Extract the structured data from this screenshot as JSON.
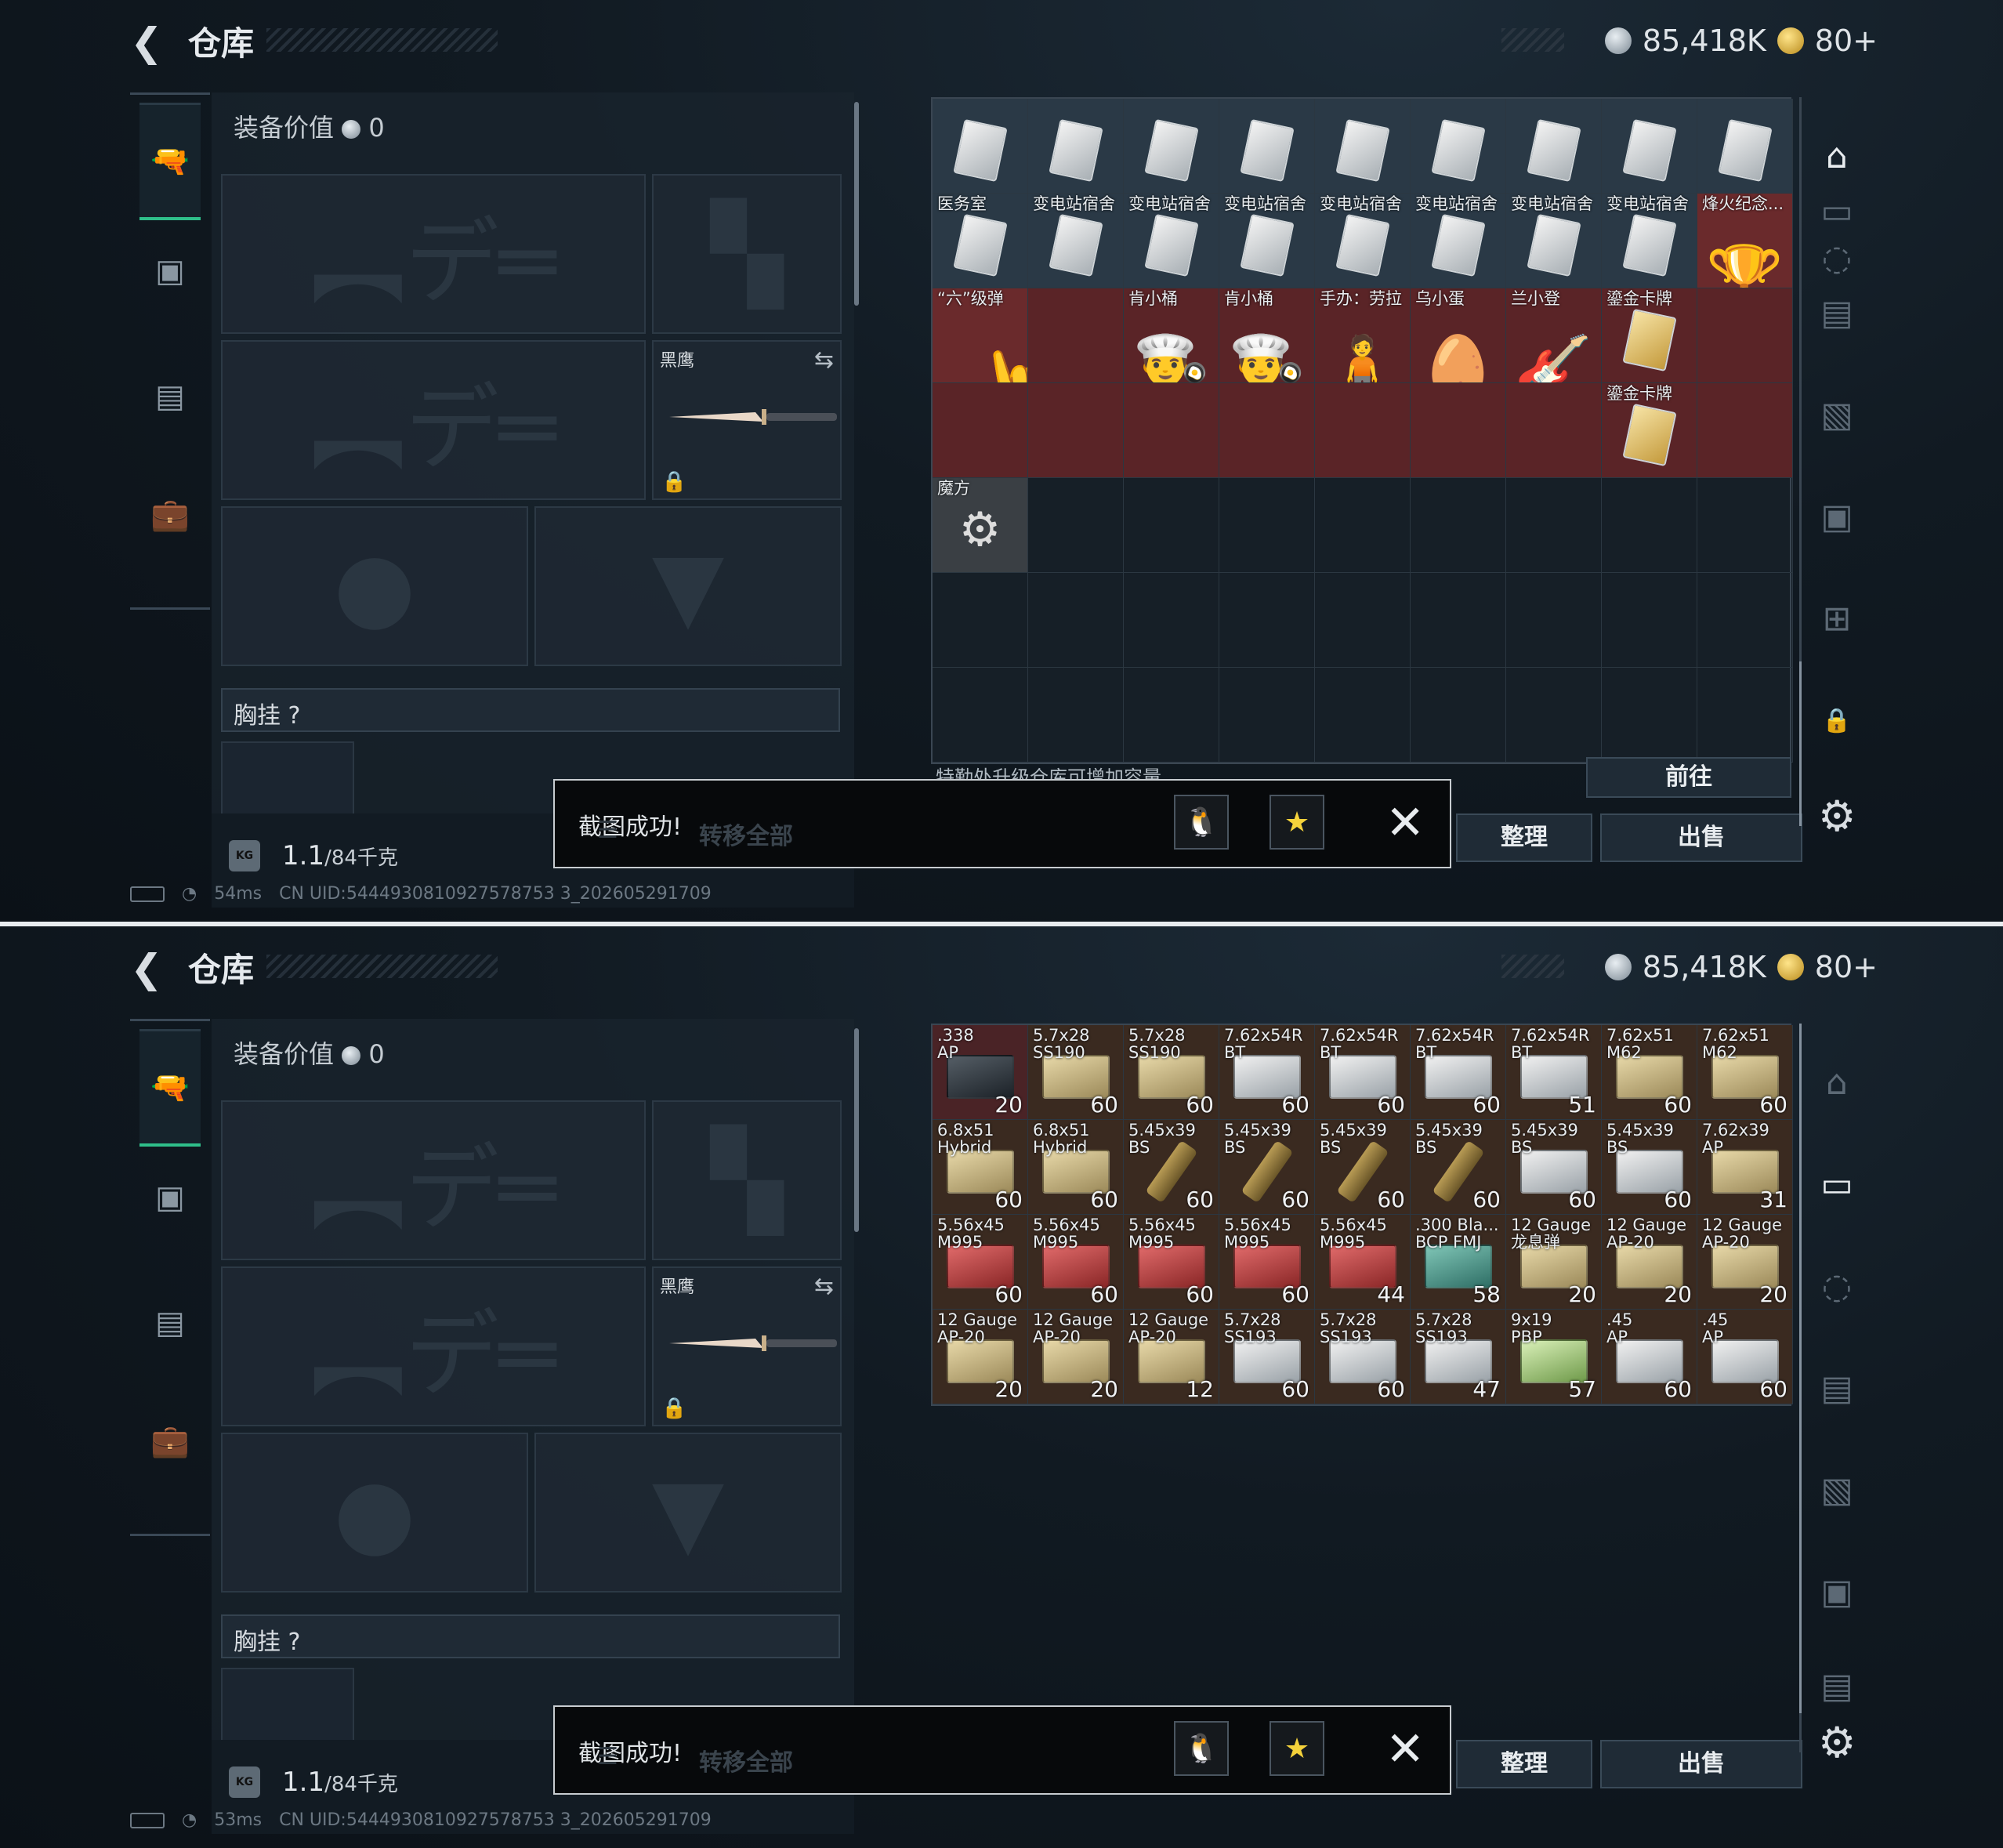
{
  "header": {
    "title": "仓库",
    "silver": "85,418K",
    "gold": "80+"
  },
  "equip": {
    "label": "装备价值",
    "value": "0",
    "knife_name": "黑鹰",
    "chest_label": "胸挂 ?",
    "weight": "1.1",
    "weight_max": "/84千克",
    "kg_icon": "KG"
  },
  "actions": {
    "go": "前往",
    "organize": "整理",
    "sell": "出售",
    "transfer_all": "转移全部",
    "upgrade_tip": "特勤处升级仓库可增加容量"
  },
  "toast": {
    "text": "截图成功!"
  },
  "status_top": {
    "ping": "54ms",
    "uid": "CN UID:5444930810927578753 3_202605291709"
  },
  "status_bottom": {
    "ping": "53ms",
    "uid": "CN UID:5444930810927578753 3_202605291709"
  },
  "top_grid": [
    {
      "name": "",
      "type": "card"
    },
    {
      "name": "",
      "type": "card"
    },
    {
      "name": "",
      "type": "card"
    },
    {
      "name": "",
      "type": "card"
    },
    {
      "name": "",
      "type": "card"
    },
    {
      "name": "",
      "type": "card"
    },
    {
      "name": "",
      "type": "card"
    },
    {
      "name": "",
      "type": "card"
    },
    {
      "name": "",
      "type": "card"
    },
    {
      "name": "医务室",
      "type": "card"
    },
    {
      "name": "变电站宿舍",
      "type": "card"
    },
    {
      "name": "变电站宿舍",
      "type": "card"
    },
    {
      "name": "变电站宿舍",
      "type": "card"
    },
    {
      "name": "变电站宿舍",
      "type": "card"
    },
    {
      "name": "变电站宿舍",
      "type": "card"
    },
    {
      "name": "变电站宿舍",
      "type": "card"
    },
    {
      "name": "变电站宿舍",
      "type": "card"
    },
    {
      "name": "烽火纪念...",
      "type": "trophy"
    },
    {
      "name": "“六”级弹",
      "type": "hand"
    },
    {
      "name": "",
      "type": "span"
    },
    {
      "name": "肯小桶",
      "type": "fig"
    },
    {
      "name": "肯小桶",
      "type": "fig"
    },
    {
      "name": "手办：劳拉",
      "type": "fig"
    },
    {
      "name": "乌小蛋",
      "type": "fig"
    },
    {
      "name": "兰小登",
      "type": "fig"
    },
    {
      "name": "鎏金卡牌",
      "type": "gold"
    },
    {
      "name": "",
      "type": "span"
    },
    {
      "name": "",
      "type": "span"
    },
    {
      "name": "",
      "type": "span"
    },
    {
      "name": "",
      "type": "span"
    },
    {
      "name": "",
      "type": "span"
    },
    {
      "name": "",
      "type": "span"
    },
    {
      "name": "",
      "type": "span"
    },
    {
      "name": "",
      "type": "span"
    },
    {
      "name": "鎏金卡牌",
      "type": "gold"
    },
    {
      "name": "",
      "type": "span"
    },
    {
      "name": "魔方",
      "type": "cube"
    }
  ],
  "bottom_grid": [
    {
      "name": ".338\nAP",
      "count": "20",
      "box": "dark"
    },
    {
      "name": "5.7x28\nSS190",
      "count": "60",
      "box": "tan"
    },
    {
      "name": "5.7x28\nSS190",
      "count": "60",
      "box": "tan"
    },
    {
      "name": "7.62x54R\nBT",
      "count": "60",
      "box": "white"
    },
    {
      "name": "7.62x54R\nBT",
      "count": "60",
      "box": "white"
    },
    {
      "name": "7.62x54R\nBT",
      "count": "60",
      "box": "white"
    },
    {
      "name": "7.62x54R\nBT",
      "count": "51",
      "box": "white"
    },
    {
      "name": "7.62x51\nM62",
      "count": "60",
      "box": "tan"
    },
    {
      "name": "7.62x51\nM62",
      "count": "60",
      "box": "tan"
    },
    {
      "name": "6.8x51\nHybrid",
      "count": "60",
      "box": "tan"
    },
    {
      "name": "6.8x51\nHybrid",
      "count": "60",
      "box": "tan"
    },
    {
      "name": "5.45x39\nBS",
      "count": "60",
      "box": "round"
    },
    {
      "name": "5.45x39\nBS",
      "count": "60",
      "box": "round"
    },
    {
      "name": "5.45x39\nBS",
      "count": "60",
      "box": "round"
    },
    {
      "name": "5.45x39\nBS",
      "count": "60",
      "box": "round"
    },
    {
      "name": "5.45x39\nBS",
      "count": "60",
      "box": "white"
    },
    {
      "name": "5.45x39\nBS",
      "count": "60",
      "box": "white"
    },
    {
      "name": "7.62x39\nAP",
      "count": "31",
      "box": "tan"
    },
    {
      "name": "5.56x45\nM995",
      "count": "60",
      "box": "red"
    },
    {
      "name": "5.56x45\nM995",
      "count": "60",
      "box": "red"
    },
    {
      "name": "5.56x45\nM995",
      "count": "60",
      "box": "red"
    },
    {
      "name": "5.56x45\nM995",
      "count": "60",
      "box": "red"
    },
    {
      "name": "5.56x45\nM995",
      "count": "44",
      "box": "red"
    },
    {
      "name": ".300 Bla...\nBCP FMJ",
      "count": "58",
      "box": "teal"
    },
    {
      "name": "12 Gauge\n龙息弹",
      "count": "20",
      "box": "tan"
    },
    {
      "name": "12 Gauge\nAP-20",
      "count": "20",
      "box": "tan"
    },
    {
      "name": "12 Gauge\nAP-20",
      "count": "20",
      "box": "tan"
    },
    {
      "name": "12 Gauge\nAP-20",
      "count": "20",
      "box": "tan"
    },
    {
      "name": "12 Gauge\nAP-20",
      "count": "20",
      "box": "tan"
    },
    {
      "name": "12 Gauge\nAP-20",
      "count": "12",
      "box": "tan"
    },
    {
      "name": "5.7x28\nSS193",
      "count": "60",
      "box": "white"
    },
    {
      "name": "5.7x28\nSS193",
      "count": "60",
      "box": "white"
    },
    {
      "name": "5.7x28\nSS193",
      "count": "47",
      "box": "white"
    },
    {
      "name": "9x19\nPBP",
      "count": "57",
      "box": "green"
    },
    {
      "name": ".45\nAP",
      "count": "60",
      "box": "white"
    },
    {
      "name": ".45\nAP",
      "count": "60",
      "box": "white"
    }
  ]
}
